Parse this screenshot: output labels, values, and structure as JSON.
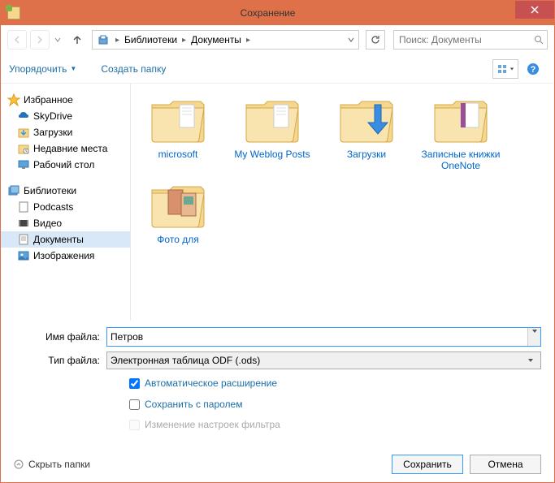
{
  "title": "Сохранение",
  "breadcrumb": {
    "seg1": "Библиотеки",
    "seg2": "Документы"
  },
  "search": {
    "placeholder": "Поиск: Документы"
  },
  "toolbar": {
    "organize": "Упорядочить",
    "newfolder": "Создать папку"
  },
  "sidebar": {
    "favorites": "Избранное",
    "skydrive": "SkyDrive",
    "downloads": "Загрузки",
    "recent": "Недавние места",
    "desktop": "Рабочий стол",
    "libraries": "Библиотеки",
    "podcasts": "Podcasts",
    "video": "Видео",
    "documents": "Документы",
    "images": "Изображения"
  },
  "folders": {
    "f1": "microsoft",
    "f2": "My Weblog Posts",
    "f3": "Загрузки",
    "f4": "Записные книжки OneNote",
    "f5": "Фото для"
  },
  "form": {
    "filename_label": "Имя файла:",
    "filename_value": "Петров",
    "filetype_label": "Тип файла:",
    "filetype_value": "Электронная таблица ODF (.ods)",
    "auto_ext": "Автоматическое расширение",
    "save_password": "Сохранить с паролем",
    "filter_settings": "Изменение настроек фильтра"
  },
  "footer": {
    "hide": "Скрыть папки",
    "save": "Сохранить",
    "cancel": "Отмена"
  }
}
